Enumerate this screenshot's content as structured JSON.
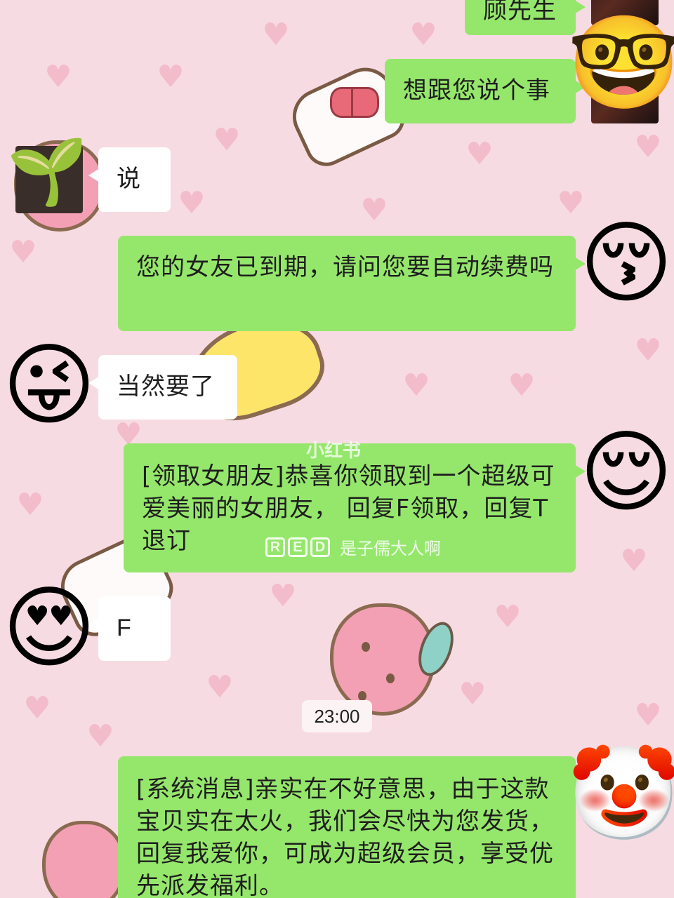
{
  "chat": {
    "messages": [
      {
        "sender": "me",
        "text": "顾先生",
        "avatar": "nerd-face-emoji"
      },
      {
        "sender": "me",
        "text": "想跟您说个事",
        "avatar": "nerd-face-emoji"
      },
      {
        "sender": "them",
        "text": "说",
        "avatar": "sprout-bean-sticker"
      },
      {
        "sender": "me",
        "text": "您的女友已到期，请问您要自动续费吗",
        "avatar": "kissing-face-emoji"
      },
      {
        "sender": "them",
        "text": "当然要了",
        "avatar": "winking-tongue-emoji"
      },
      {
        "sender": "me",
        "text": "[领取女朋友]恭喜你领取到一个超级可爱美丽的女朋友， 回复F领取，回复T退订",
        "avatar": "relieved-face-emoji"
      },
      {
        "sender": "them",
        "text": "F",
        "avatar": "heart-eyes-emoji"
      },
      {
        "sender": "me",
        "text": "[系统消息]亲实在不好意思，由于这款宝贝实在太火，我们会尽快为您发货，回复我爱你，可成为超级会员，享受优先派发福利。",
        "avatar": "clown-face-emoji"
      }
    ],
    "timestamp": "23:00"
  },
  "watermark": {
    "top_text": "小红书",
    "brand_letters": [
      "R",
      "E",
      "D"
    ],
    "username": "是子儒大人啊"
  },
  "colors": {
    "background": "#f7dbe2",
    "my_bubble": "#95e76c",
    "their_bubble": "#ffffff"
  }
}
